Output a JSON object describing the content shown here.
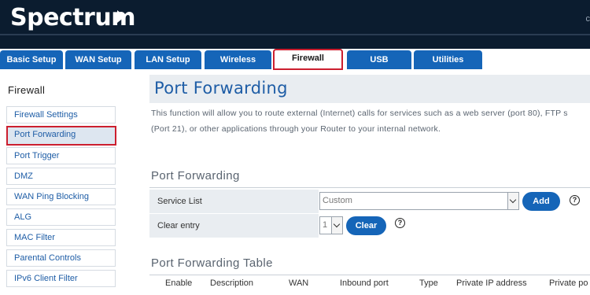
{
  "header": {
    "logo": "Spectrum",
    "corner": "c"
  },
  "tabs": [
    {
      "label": "Basic Setup"
    },
    {
      "label": "WAN Setup"
    },
    {
      "label": "LAN Setup"
    },
    {
      "label": "Wireless"
    },
    {
      "label": "Firewall",
      "active": true
    },
    {
      "label": "USB"
    },
    {
      "label": "Utilities"
    }
  ],
  "sidebar": {
    "title": "Firewall",
    "items": [
      {
        "label": "Firewall Settings"
      },
      {
        "label": "Port Forwarding",
        "active": true
      },
      {
        "label": "Port Trigger"
      },
      {
        "label": "DMZ"
      },
      {
        "label": "WAN Ping Blocking"
      },
      {
        "label": "ALG"
      },
      {
        "label": "MAC Filter"
      },
      {
        "label": "Parental Controls"
      },
      {
        "label": "IPv6 Client Filter"
      }
    ]
  },
  "main": {
    "title": "Port Forwarding",
    "description_line1": "This function will allow you to route external (Internet) calls for services such as a web server (port 80), FTP s",
    "description_line2": "(Port 21), or other applications through your Router to your internal network.",
    "section_title": "Port Forwarding",
    "service_list": {
      "label": "Service List",
      "value": "Custom",
      "button": "Add",
      "help": "?"
    },
    "clear_entry": {
      "label": "Clear entry",
      "value": "1",
      "button": "Clear",
      "help": "?"
    },
    "table_title": "Port Forwarding Table",
    "table_headers": [
      "Enable",
      "Description",
      "WAN",
      "Inbound port",
      "Type",
      "Private IP address",
      "Private po"
    ]
  },
  "colors": {
    "accent": "#1565b8",
    "header_bg": "#0b1c2f",
    "highlight_red": "#cc1f2f"
  }
}
